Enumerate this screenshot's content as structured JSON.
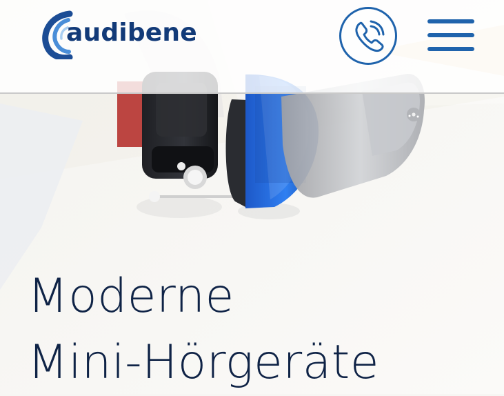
{
  "header": {
    "logo_text": "audibene",
    "phone_icon": "phone-ring-icon",
    "menu_icon": "hamburger-menu-icon"
  },
  "hero": {
    "headline_lines": [
      "Moderne",
      "Mini-Hörgeräte"
    ]
  },
  "colors": {
    "brand_blue": "#1f63ac",
    "logo_text": "#123a78",
    "headline": "#0f2346"
  }
}
